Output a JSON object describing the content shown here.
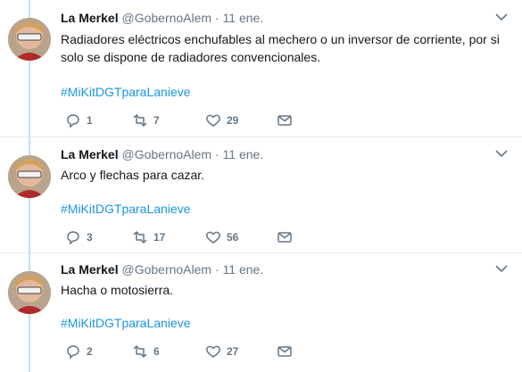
{
  "tweets": [
    {
      "name": "La Merkel",
      "handle": "@GobernoAlem",
      "separator": "·",
      "time": "11 ene.",
      "text": "Radiadores eléctricos enchufables al mechero o un inversor de corriente, por si solo se dispone de radiadores convencionales.",
      "hashtag": "#MiKitDGTparaLanieve",
      "replies": "1",
      "retweets": "7",
      "likes": "29"
    },
    {
      "name": "La Merkel",
      "handle": "@GobernoAlem",
      "separator": "·",
      "time": "11 ene.",
      "text": "Arco y flechas para cazar.",
      "hashtag": "#MiKitDGTparaLanieve",
      "replies": "3",
      "retweets": "17",
      "likes": "56"
    },
    {
      "name": "La Merkel",
      "handle": "@GobernoAlem",
      "separator": "·",
      "time": "11 ene.",
      "text": "Hacha o motosierra.",
      "hashtag": "#MiKitDGTparaLanieve",
      "replies": "2",
      "retweets": "6",
      "likes": "27"
    }
  ],
  "colors": {
    "link": "#1b95e0",
    "secondary_text": "#657786",
    "thread_line": "#c4e0f0"
  },
  "icons": [
    "reply-icon",
    "retweet-icon",
    "like-icon",
    "message-icon",
    "chevron-down-icon"
  ]
}
